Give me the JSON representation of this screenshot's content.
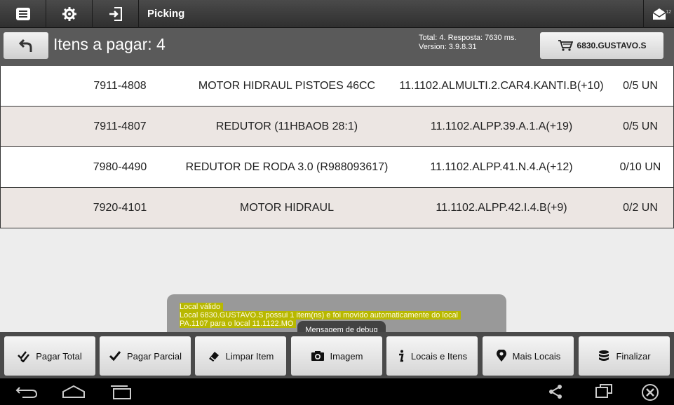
{
  "actionbar": {
    "title": "Picking",
    "mail_badge": "12",
    "icons": [
      "menu-icon",
      "settings-icon",
      "login-icon",
      "mail-icon"
    ]
  },
  "header": {
    "title": "Itens a pagar: 4",
    "info_line1": "Total: 4. Resposta: 7630 ms.",
    "info_line2": "Version: 3.9.8.31",
    "user_label": "6830.GUSTAVO.S"
  },
  "items": [
    {
      "code": "7911-4808",
      "desc": "MOTOR HIDRAUL PISTOES 46CC",
      "loc": "11.1102.ALMULTI.2.CAR4.KANTI.B(+10)",
      "qty": "0/5 UN"
    },
    {
      "code": "7911-4807",
      "desc": "REDUTOR (11HBAOB 28:1)",
      "loc": "11.1102.ALPP.39.A.1.A(+19)",
      "qty": "0/5 UN"
    },
    {
      "code": "7980-4490",
      "desc": "REDUTOR DE RODA 3.0 (R988093617)",
      "loc": "11.1102.ALPP.41.N.4.A(+12)",
      "qty": "0/10 UN"
    },
    {
      "code": "7920-4101",
      "desc": "MOTOR HIDRAUL",
      "loc": "11.1102.ALPP.42.I.4.B(+9)",
      "qty": "0/2 UN"
    }
  ],
  "toast": {
    "line1": "Local válido",
    "line2": "Local 6830.GUSTAVO.S possui 1 item(ns) e foi movido automaticamente do local",
    "line3": "PA.1107 para o local 11.1122.MO",
    "debug": "Mensagem de debug"
  },
  "buttons": {
    "pagar_total": "Pagar Total",
    "pagar_parcial": "Pagar Parcial",
    "limpar_item": "Limpar Item",
    "imagem": "Imagem",
    "locais_itens": "Locais e Itens",
    "mais_locais": "Mais Locais",
    "finalizar": "Finalizar"
  },
  "colors": {
    "actionbar": "#3a3a3a",
    "header": "#5a5a5a",
    "row_even": "#ece6e3",
    "highlight": "#b8b800"
  }
}
